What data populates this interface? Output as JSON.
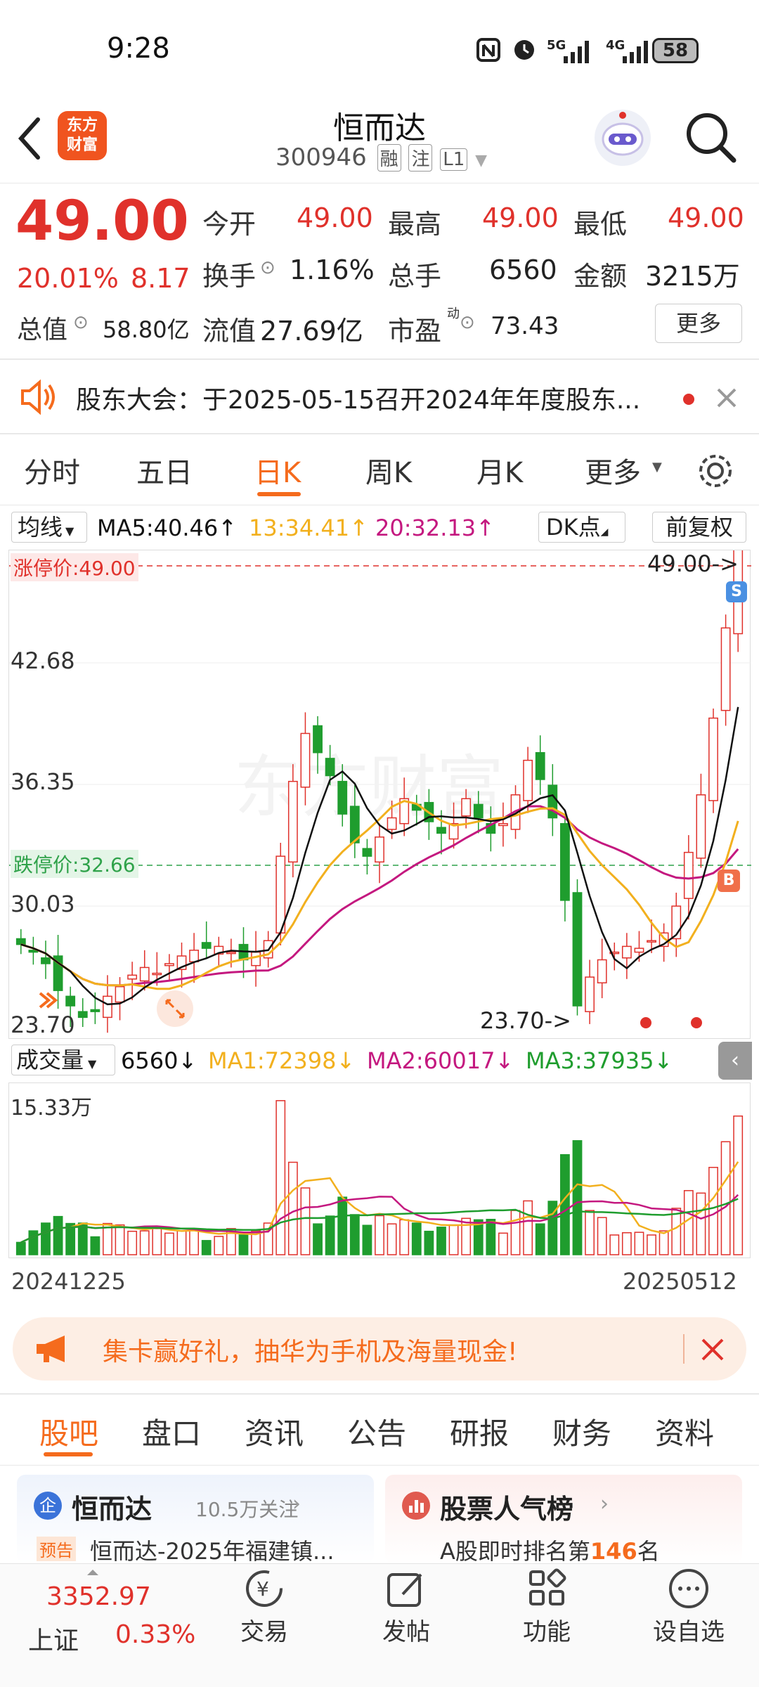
{
  "status_bar": {
    "time": "9:28",
    "battery": "58",
    "net1": "5G",
    "net2": "4G"
  },
  "header": {
    "title": "恒而达",
    "code": "300946",
    "badges": [
      "融",
      "注",
      "L1"
    ],
    "logo_line1": "东方",
    "logo_line2": "财富"
  },
  "quote": {
    "price": "49.00",
    "change_pct": "20.01%",
    "change": "8.17",
    "open_label": "今开",
    "open": "49.00",
    "high_label": "最高",
    "high": "49.00",
    "low_label": "最低",
    "low": "49.00",
    "turnover_label": "换手",
    "turnover": "1.16%",
    "volume_label": "总手",
    "volume": "6560",
    "amount_label": "金额",
    "amount": "3215万",
    "mktcap_label": "总值",
    "mktcap": "58.80亿",
    "float_label": "流值",
    "float": "27.69亿",
    "pe_label": "市盈",
    "pe_sup": "动",
    "pe": "73.43",
    "more": "更多"
  },
  "notice": {
    "text": "股东大会：于2025-05-15召开2024年年度股东..."
  },
  "chart_tabs": [
    "分时",
    "五日",
    "日K",
    "周K",
    "月K",
    "更多"
  ],
  "active_tab": 2,
  "ma_bar": {
    "selector": "均线",
    "ma5": "MA5:40.46↑",
    "ma10": "13:34.41↑",
    "ma20": "20:32.13↑",
    "dk": "DK点",
    "adjust": "前复权"
  },
  "kline": {
    "limit_up_label": "涨停价:49.00",
    "limit_down_label": "跌停价:32.66",
    "y_labels": [
      "42.68",
      "36.35",
      "30.03",
      "23.70"
    ],
    "high_marker": "49.00->",
    "low_marker": "23.70->",
    "watermark": "东方财富",
    "s_badge": "S",
    "b_badge": "B"
  },
  "vol_bar": {
    "selector": "成交量",
    "vol": "6560↓",
    "ma1": "MA1:72398↓",
    "ma2": "MA2:60017↓",
    "ma3": "MA3:37935↓",
    "max_label": "15.33万"
  },
  "dates": {
    "start": "20241225",
    "end": "20250512"
  },
  "promo": {
    "text": "集卡赢好礼，抽华为手机及海量现金!"
  },
  "bottom_tabs": [
    "股吧",
    "盘口",
    "资讯",
    "公告",
    "研报",
    "财务",
    "资料"
  ],
  "cards": {
    "left_title": "恒而达",
    "left_follow": "10.5万关注",
    "left_tag": "预告",
    "left_text": "恒而达-2025年福建镇...",
    "right_title": "股票人气榜",
    "right_text_a": "A股即时排名第",
    "right_rank": "146",
    "right_text_b": "名"
  },
  "nav": {
    "index_value": "3352.97",
    "index_name": "上证",
    "index_pct": "0.33%",
    "items": [
      "交易",
      "发帖",
      "功能",
      "设自选"
    ]
  },
  "colors": {
    "up": "#e0312b",
    "down": "#1f9d2e",
    "accent": "#f56b1d",
    "ma5": "#111111",
    "ma10": "#f2b01e",
    "ma20": "#c4187f"
  },
  "chart_data": {
    "type": "candlestick",
    "ma_lines": [
      "MA5",
      "MA10",
      "MA20"
    ],
    "y_ticks": [
      42.68,
      36.35,
      30.03,
      23.7
    ],
    "close_approx": [
      28.0,
      27.6,
      27.0,
      25.6,
      24.8,
      24.2,
      24.5,
      25.3,
      25.8,
      26.4,
      26.8,
      26.5,
      27.0,
      27.4,
      27.7,
      27.8,
      27.9,
      27.6,
      27.2,
      27.6,
      28.2,
      32.6,
      36.5,
      39.0,
      38.0,
      36.8,
      34.8,
      33.3,
      32.6,
      33.6,
      34.6,
      35.6,
      35.0,
      34.4,
      33.8,
      34.3,
      35.6,
      34.6,
      33.8,
      34.3,
      35.8,
      37.6,
      36.6,
      34.6,
      30.3,
      24.8,
      26.3,
      27.2,
      27.6,
      27.9,
      27.8,
      28.2,
      28.6,
      30.0,
      32.8,
      35.8,
      39.8,
      44.5,
      49.0
    ]
  }
}
